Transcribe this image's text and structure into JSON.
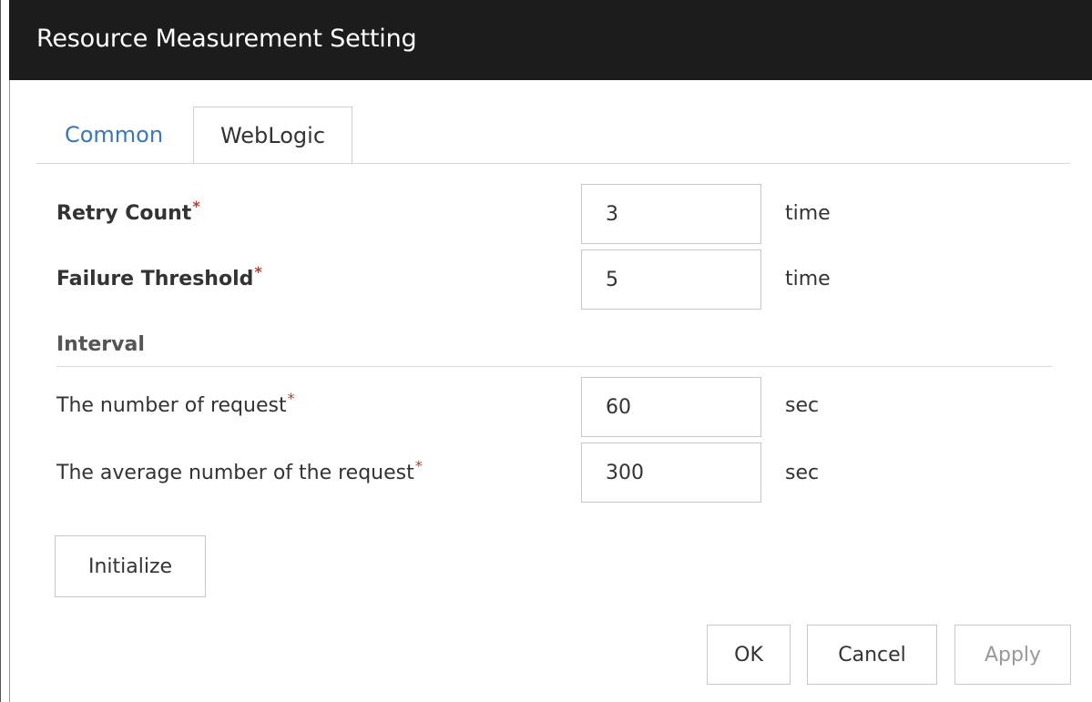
{
  "window": {
    "title": "Resource Measurement Setting"
  },
  "tabs": [
    {
      "label": "Common",
      "active": false
    },
    {
      "label": "WebLogic",
      "active": true
    }
  ],
  "required_marker": "*",
  "fields": {
    "retry_count": {
      "label": "Retry Count",
      "value": "3",
      "unit": "time"
    },
    "failure_threshold": {
      "label": "Failure Threshold",
      "value": "5",
      "unit": "time"
    },
    "interval_section": {
      "title": "Interval"
    },
    "number_of_request": {
      "label": "The number of request",
      "value": "60",
      "unit": "sec"
    },
    "average_number_of_request": {
      "label": "The average number of the request",
      "value": "300",
      "unit": "sec"
    }
  },
  "buttons": {
    "initialize": "Initialize",
    "ok": "OK",
    "cancel": "Cancel",
    "apply": "Apply"
  },
  "colors": {
    "titlebar": "#1c1c1c",
    "link_tab": "#3a78b8",
    "required": "#c0392b"
  }
}
